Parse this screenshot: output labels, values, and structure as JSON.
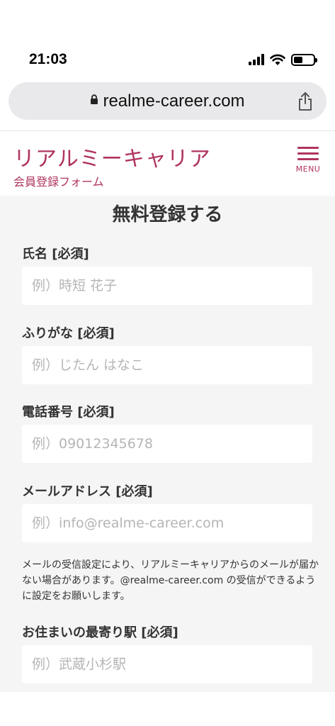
{
  "status_bar": {
    "time": "21:03"
  },
  "browser": {
    "url": "realme-career.com"
  },
  "header": {
    "logo": "リアルミーキャリア",
    "subtitle": "会員登録フォーム",
    "menu_label": "MENU"
  },
  "form": {
    "title": "無料登録する",
    "fields": [
      {
        "label": "氏名 [必須]",
        "placeholder": "例）時短 花子"
      },
      {
        "label": "ふりがな [必須]",
        "placeholder": "例）じたん はなこ"
      },
      {
        "label": "電話番号 [必須]",
        "placeholder": "例）09012345678"
      },
      {
        "label": "メールアドレス [必須]",
        "placeholder": "例）info@realme-career.com"
      },
      {
        "label": "お住まいの最寄り駅 [必須]",
        "placeholder": "例）武蔵小杉駅"
      }
    ],
    "email_note": "メールの受信設定により、リアルミーキャリアからのメールが届かない場合があります。@realme-career.com の受信ができるように設定をお願いします。"
  },
  "colors": {
    "brand": "#b0345e",
    "form_background": "#f5f5f5",
    "url_bar": "#e9e9eb"
  }
}
